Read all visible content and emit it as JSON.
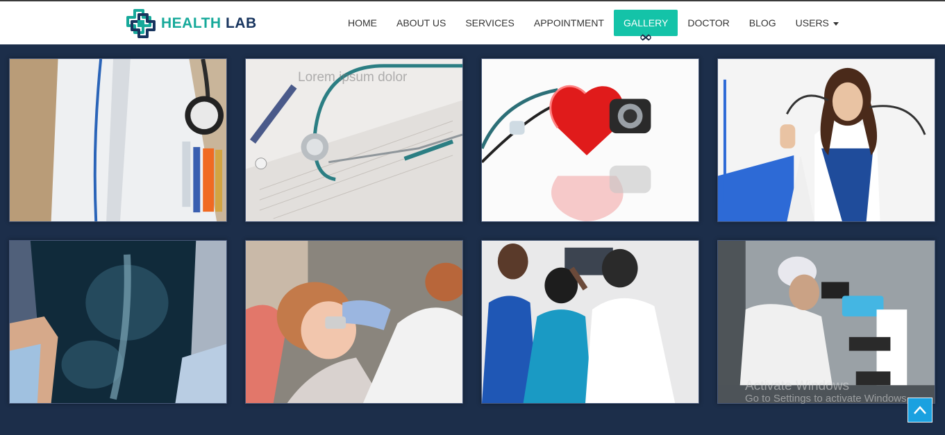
{
  "brand": {
    "prefix": "HEALTH",
    "suffix": "LAB",
    "logo_icon": "medical-cross-logo-icon"
  },
  "nav": {
    "items": [
      {
        "label": "HOME"
      },
      {
        "label": "ABOUT US"
      },
      {
        "label": "SERVICES"
      },
      {
        "label": "APPOINTMENT"
      },
      {
        "label": "GALLERY",
        "active": true
      },
      {
        "label": "DOCTOR"
      },
      {
        "label": "BLOG"
      },
      {
        "label": "USERS",
        "dropdown": true
      }
    ],
    "active_color": "#14c3a8"
  },
  "gallery": {
    "background": "#1c2e4a",
    "tiles": [
      {
        "subject": "doctor-coat-stethoscope-photo"
      },
      {
        "subject": "stethoscope-on-form-photo",
        "caption": "Lorem ipsum dolor"
      },
      {
        "subject": "red-heart-stethoscope-photo"
      },
      {
        "subject": "female-doctor-photo"
      },
      {
        "subject": "xray-film-photo"
      },
      {
        "subject": "dental-exam-photo"
      },
      {
        "subject": "doctors-viewing-xray-photo"
      },
      {
        "subject": "lab-microscope-photo"
      }
    ]
  },
  "watermark": {
    "title": "Activate Windows",
    "subtitle": "Go to Settings to activate Windows."
  },
  "scroll_top": {
    "icon": "chevron-up-icon",
    "color": "#1aa1e0"
  }
}
